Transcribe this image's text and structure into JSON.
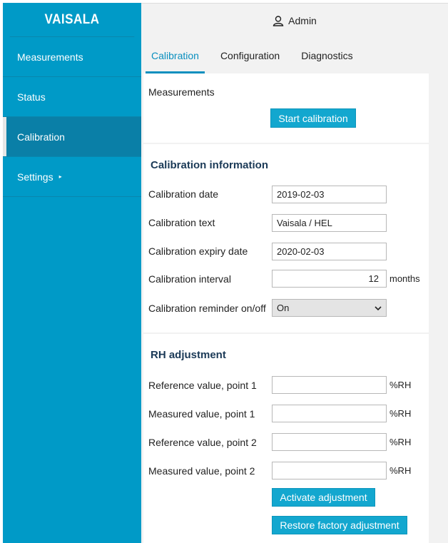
{
  "app": {
    "logo": "VAISALA"
  },
  "sidebar": {
    "items": [
      {
        "label": "Measurements"
      },
      {
        "label": "Status"
      },
      {
        "label": "Calibration"
      },
      {
        "label": "Settings",
        "caret": "▸"
      }
    ]
  },
  "topbar": {
    "user": "Admin"
  },
  "tabs": [
    {
      "label": "Calibration"
    },
    {
      "label": "Configuration"
    },
    {
      "label": "Diagnostics"
    }
  ],
  "measurements_section": {
    "label": "Measurements",
    "start_button": "Start calibration"
  },
  "calibration_info": {
    "heading": "Calibration information",
    "date_label": "Calibration date",
    "date_value": "2019-02-03",
    "text_label": "Calibration text",
    "text_value": "Vaisala / HEL",
    "expiry_label": "Calibration expiry date",
    "expiry_value": "2020-02-03",
    "interval_label": "Calibration interval",
    "interval_value": "12",
    "interval_unit": "months",
    "reminder_label": "Calibration reminder on/off",
    "reminder_value": "On"
  },
  "rh_adjustment": {
    "heading": "RH adjustment",
    "ref1_label": "Reference value, point 1",
    "meas1_label": "Measured value, point 1",
    "ref2_label": "Reference value, point 2",
    "meas2_label": "Measured value, point 2",
    "unit": "%RH",
    "activate_button": "Activate adjustment",
    "restore_button": "Restore factory adjustment"
  },
  "colors": {
    "sidebar": "#009ac7",
    "accent": "#0a8fbf",
    "button": "#13a7cf"
  }
}
